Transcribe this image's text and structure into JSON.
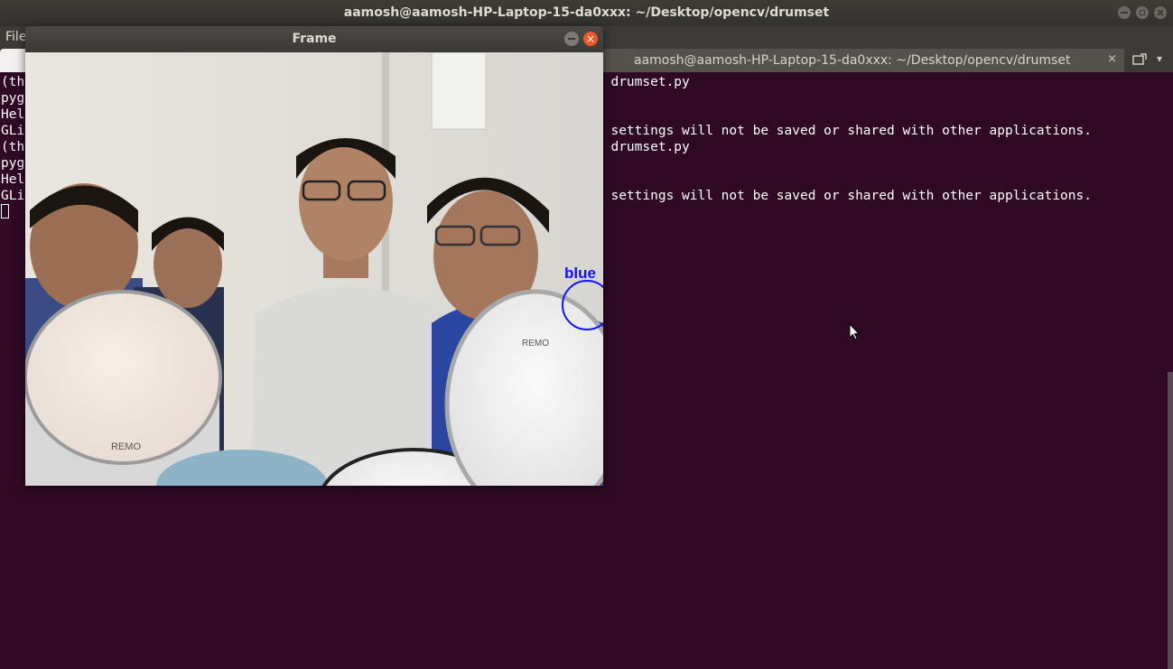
{
  "terminal": {
    "window_title": "aamosh@aamosh-HP-Laptop-15-da0xxx: ~/Desktop/opencv/drumset",
    "menu_first": "File",
    "tab_title": "aamosh@aamosh-HP-Laptop-15-da0xxx: ~/Desktop/opencv/drumset",
    "tab_close": "×",
    "lines": [
      {
        "left": "(th",
        "right": "n drumset.py"
      },
      {
        "left": "pyg",
        "right": ""
      },
      {
        "left": "Hel",
        "right": ""
      },
      {
        "left": "GLi",
        "right": "r settings will not be saved or shared with other applications."
      },
      {
        "left": "(th",
        "right": "n drumset.py"
      },
      {
        "left": "pyg",
        "right": ""
      },
      {
        "left": "Hel",
        "right": ""
      },
      {
        "left": "GLi",
        "right": "r settings will not be saved or shared with other applications."
      }
    ]
  },
  "frame_window": {
    "title": "Frame",
    "close_glyph": "×",
    "overlay_label": "blue"
  },
  "colors": {
    "terminal_bg": "#300a24",
    "titlebar_bg": "#3c3b37",
    "detect_circle": "#1111ff",
    "close_button": "#f0592b"
  }
}
